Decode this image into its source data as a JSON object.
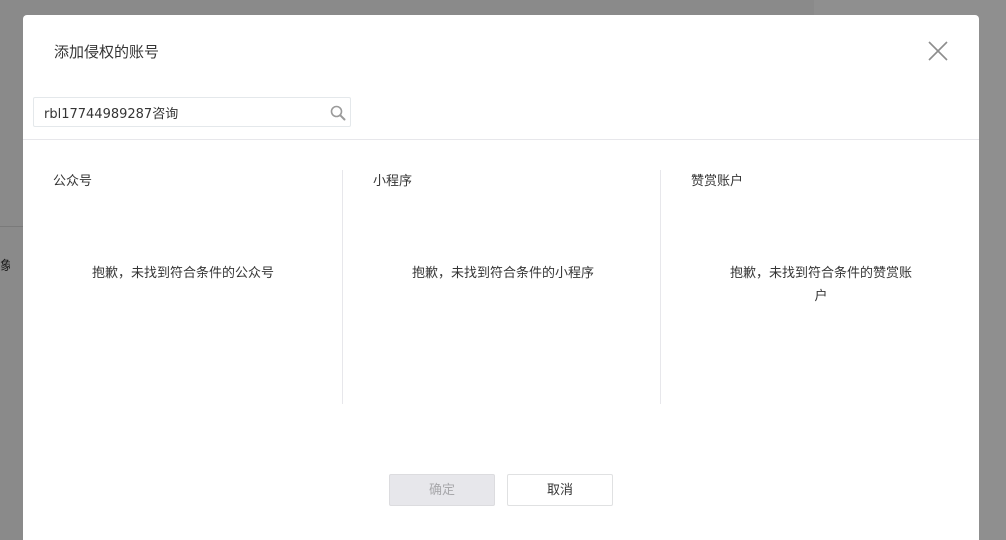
{
  "backdrop": {
    "partial_char": "象"
  },
  "dialog": {
    "title": "添加侵权的账号",
    "search": {
      "value": "rbl17744989287咨询",
      "placeholder": ""
    },
    "columns": [
      {
        "title": "公众号",
        "empty_text": "抱歉，未找到符合条件的公众号"
      },
      {
        "title": "小程序",
        "empty_text": "抱歉，未找到符合条件的小程序"
      },
      {
        "title": "赞赏账户",
        "empty_text": "抱歉，未找到符合条件的赞赏账户"
      }
    ],
    "buttons": {
      "confirm_label": "确定",
      "cancel_label": "取消"
    }
  },
  "icons": {
    "close": "close-icon",
    "search": "search-icon"
  },
  "colors": {
    "overlay": "#848484",
    "text": "#353535",
    "border": "#e7e7eb",
    "disabled_bg": "#e7e7eb",
    "disabled_text": "#a8a8ab"
  }
}
